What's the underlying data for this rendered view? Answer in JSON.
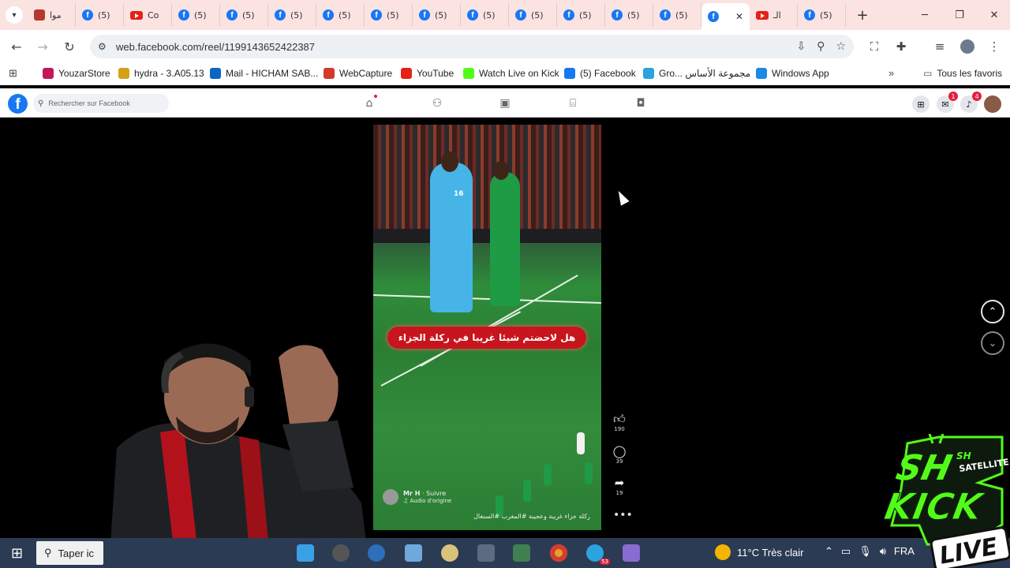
{
  "browser": {
    "tabs": [
      {
        "title": "موا",
        "icon": "emblem-icon"
      },
      {
        "title": "(5)",
        "icon": "facebook-icon"
      },
      {
        "title": "Co",
        "icon": "youtube-icon"
      },
      {
        "title": "(5)",
        "icon": "facebook-icon"
      },
      {
        "title": "(5)",
        "icon": "facebook-icon"
      },
      {
        "title": "(5)",
        "icon": "facebook-icon"
      },
      {
        "title": "(5)",
        "icon": "facebook-icon"
      },
      {
        "title": "(5)",
        "icon": "facebook-icon"
      },
      {
        "title": "(5)",
        "icon": "facebook-icon"
      },
      {
        "title": "(5)",
        "icon": "facebook-icon"
      },
      {
        "title": "(5)",
        "icon": "facebook-icon"
      },
      {
        "title": "(5)",
        "icon": "facebook-icon"
      },
      {
        "title": "(5)",
        "icon": "facebook-icon"
      },
      {
        "title": "(5)",
        "icon": "facebook-icon"
      },
      {
        "title": "",
        "icon": "facebook-icon",
        "active": true
      },
      {
        "title": "الـ",
        "icon": "youtube-icon"
      },
      {
        "title": "(5)",
        "icon": "facebook-icon"
      }
    ],
    "url": "web.facebook.com/reel/1199143652422387",
    "bookmarks": [
      {
        "label": "YouzarStore",
        "color": "#c2185b"
      },
      {
        "label": "hydra - 3.A05.13",
        "color": "#d4a017"
      },
      {
        "label": "Mail - HICHAM SAB...",
        "color": "#0a66c2"
      },
      {
        "label": "WebCapture",
        "color": "#d23b2a"
      },
      {
        "label": "YouTube",
        "color": "#e62117"
      },
      {
        "label": "Watch Live on Kick",
        "color": "#53fc18"
      },
      {
        "label": "(5) Facebook",
        "color": "#1877f2"
      },
      {
        "label": "Gro... مجموعة الأساس",
        "color": "#2aa3df"
      },
      {
        "label": "Windows App",
        "color": "#1e88e5"
      }
    ],
    "all_bookmarks": "Tous les favoris"
  },
  "facebook": {
    "search_placeholder": "Rechercher sur Facebook",
    "messenger_badge": "1",
    "notifications_badge": "4"
  },
  "reel": {
    "overlay_caption": "هل لاحضتم شيئا غريبا في ركلة الجزاء",
    "author": "Mr H",
    "follow": "· Suivre",
    "audio": "Audio d'origine",
    "description": "ركلة جزاء غريبة وعجيبة #المغرب #السنغال",
    "likes": "190",
    "comments": "39",
    "shares": "19",
    "jersey_number": "16"
  },
  "taskbar": {
    "search_placeholder": "Taper ic",
    "weather": "11°C  Très clair",
    "language": "FRA",
    "chrome_badge": "53"
  },
  "overlay_logo": {
    "sh": "SH",
    "satellite": "SATELLITE",
    "kick": "KICK",
    "live": "LIVE"
  }
}
